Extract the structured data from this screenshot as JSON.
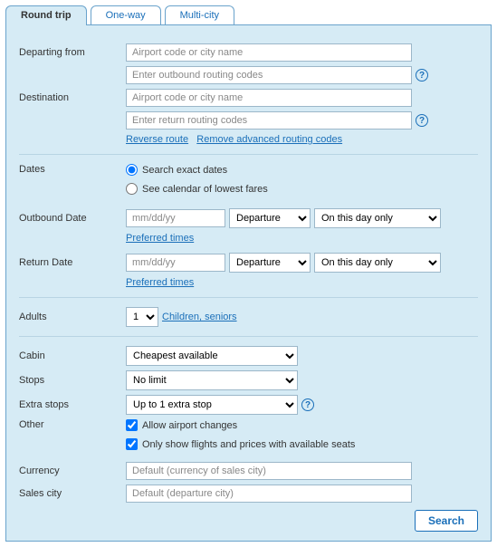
{
  "tabs": {
    "round_trip": "Round trip",
    "one_way": "One-way",
    "multi_city": "Multi-city"
  },
  "labels": {
    "departing_from": "Departing from",
    "destination": "Destination",
    "dates": "Dates",
    "outbound_date": "Outbound Date",
    "return_date": "Return Date",
    "adults": "Adults",
    "cabin": "Cabin",
    "stops": "Stops",
    "extra_stops": "Extra stops",
    "other": "Other",
    "currency": "Currency",
    "sales_city": "Sales city"
  },
  "placeholders": {
    "airport": "Airport code or city name",
    "outbound_routing": "Enter outbound routing codes",
    "return_routing": "Enter return routing codes",
    "date": "mm/dd/yy",
    "currency": "Default (currency of sales city)",
    "sales_city": "Default (departure city)"
  },
  "links": {
    "reverse_route": "Reverse route",
    "remove_routing": "Remove advanced routing codes",
    "preferred_times": "Preferred times",
    "children_seniors": "Children, seniors"
  },
  "radios": {
    "exact_dates": "Search exact dates",
    "calendar_fares": "See calendar of lowest fares"
  },
  "selects": {
    "departure": "Departure",
    "on_this_day": "On this day only",
    "adults_value": "1",
    "cabin_value": "Cheapest available",
    "stops_value": "No limit",
    "extra_stops_value": "Up to 1 extra stop"
  },
  "checks": {
    "allow_airport_changes": "Allow airport changes",
    "only_available": "Only show flights and prices with available seats"
  },
  "buttons": {
    "search": "Search"
  },
  "help_glyph": "?"
}
